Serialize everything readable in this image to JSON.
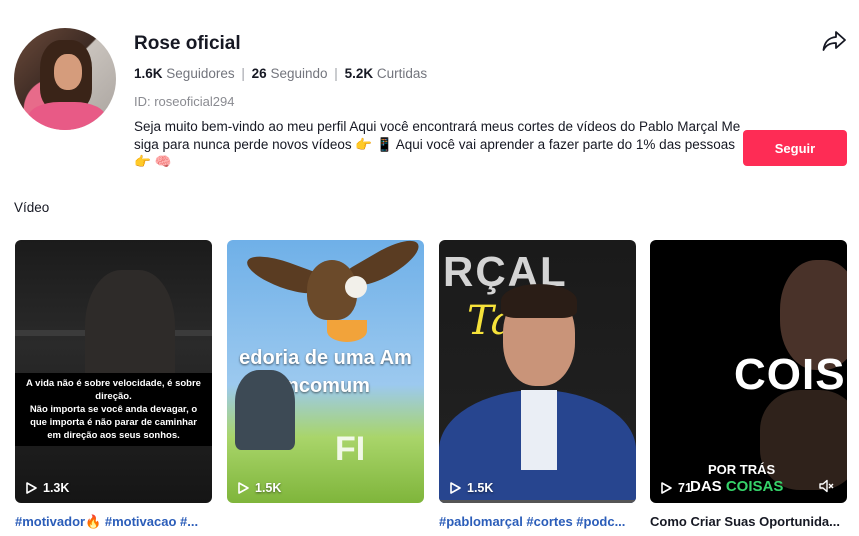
{
  "profile": {
    "name": "Rose oficial",
    "followers_count": "1.6K",
    "followers_label": "Seguidores",
    "following_count": "26",
    "following_label": "Seguindo",
    "likes_count": "5.2K",
    "likes_label": "Curtidas",
    "separator": "|",
    "id_text": "ID: roseoficial294",
    "bio": "Seja muito bem-vindo ao meu perfil Aqui você encontrará meus cortes de vídeos do Pablo Marçal Me siga para nunca perde novos vídeos 👉 📱 Aqui você vai aprender a fazer parte do 1% das pessoas 👉 🧠"
  },
  "actions": {
    "follow_label": "Seguir",
    "share_icon": "share-icon"
  },
  "section": {
    "title": "Vídeo"
  },
  "videos": [
    {
      "views": "1.3K",
      "overlay_text": "A vida não é sobre velocidade, é sobre direção.\nNão importa se você anda devagar, o que importa é não parar de caminhar em direção aos seus sonhos.",
      "caption": "#motivador🔥 #motivacao #..."
    },
    {
      "views": "1.5K",
      "overlay_text": "edoria de uma Am\nIncomum",
      "logo_text": "FI",
      "caption": ""
    },
    {
      "views": "1.5K",
      "overlay_text": "RÇAL",
      "overlay_text2": "Tal",
      "caption": "#pablomarçal #cortes #podc..."
    },
    {
      "views": "71",
      "overlay_text": "COIS",
      "overlay_sub1": "POR TRÁS",
      "overlay_sub2_a": "DAS",
      "overlay_sub2_b": "COISAS",
      "caption": "Como Criar Suas Oportunida..."
    }
  ],
  "colors": {
    "accent": "#fe2c55",
    "hashtag": "#2b5db9",
    "muted_text": "#73757d"
  }
}
